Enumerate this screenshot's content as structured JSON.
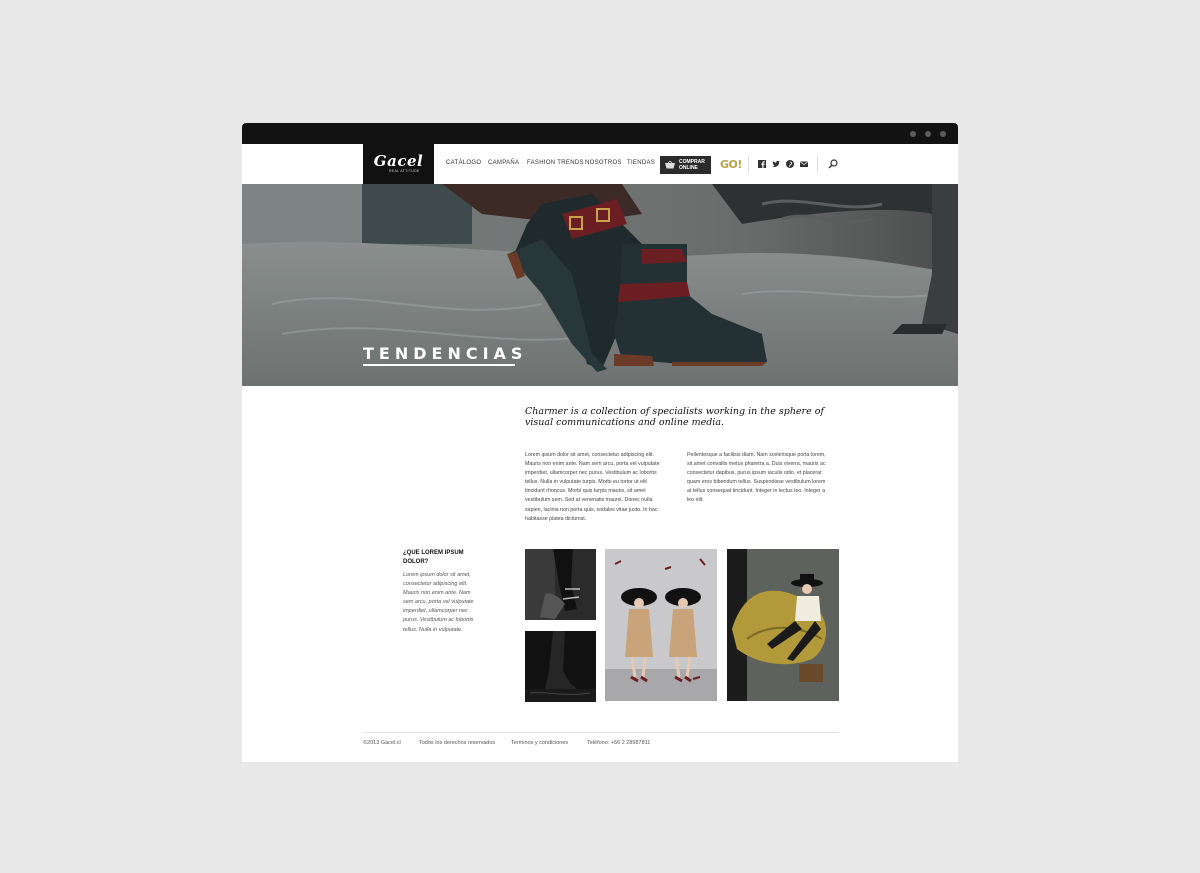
{
  "brand": {
    "name": "Gacel",
    "tagline": "REAL ATTITUDE"
  },
  "nav": {
    "items": [
      "CATÁLOGO",
      "CAMPAÑA",
      "FASHION TRENDS",
      "NOSOTROS",
      "TIENDAS"
    ],
    "buy_line1": "COMPRAR",
    "buy_line2": "ONLINE",
    "go_label": "GO!",
    "social_icons": [
      "facebook-icon",
      "twitter-icon",
      "pinterest-icon",
      "mail-icon"
    ],
    "search_icon": "search-icon"
  },
  "hero": {
    "title": "TENDENCIAS"
  },
  "intro": {
    "headline": "Charmer is a collection of specialists working in the sphere of visual communications and online media.",
    "col1": "Lorem ipsum dolor sit amet, consectetur adipiscing elit. Mauris non enim ante. Nam sem arcu, porta vel vulputate imperdiet, ullamcorper nec purus. Vestibulum ac lobortis tellus. Nulla in vulputate turpis. Morbi eu tortor ut elit tincidunt rhoncus. Morbi quis turpis mauris, sit amet vestibulum sem. Sed at venenatis mauris. Donec nulla sapien, lacinia non porta quis, sodales vitae justo. In hac habitasse platea dictumst.",
    "col2": "Pellentesque a facilisis diam. Nam scelerisque porta lorem, sit amet convallis metus pharetra a. Duis viverra, mauris ac consectetur dapibus, purus ipsum iaculis odio, et placerat quam eros bibendum tellus. Suspendisse vestibulum lorem at tellus consequat tincidunt. Integer in lectus leo. Integer a leo elit."
  },
  "side": {
    "title": "¿QUE LOREM IPSUM DOLOR?",
    "text": "Lorem ipsum dolor sit amet, consectetur adipiscing elit. Mauris non enim ante. Nam sem arcu, porta vel vulputate imperdiet, ullamcorper nec purus. Vestibulum ac lobortis tellus. Nulla in vulputate."
  },
  "footer": {
    "copyright": "©2013 Gacel.cl",
    "rights": "Todos los derechos reservados",
    "terms": "Terminos y condiciones",
    "phone": "Teléfono: +56 2 28987811"
  },
  "colors": {
    "nav_dark": "#111111",
    "accent_gold": "#b9a24a",
    "page_bg": "#e8e8e8"
  }
}
